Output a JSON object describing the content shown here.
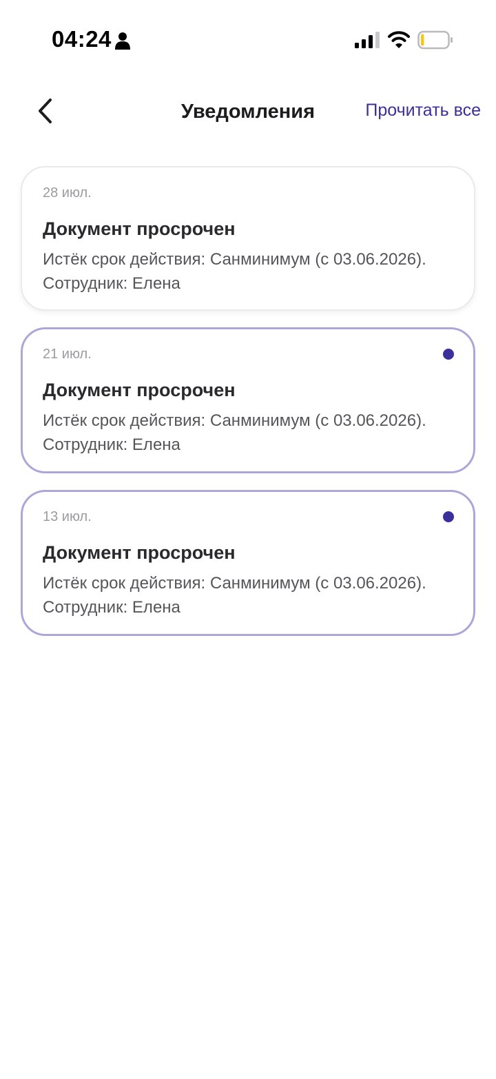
{
  "status_bar": {
    "time": "04:24",
    "icons": [
      "person-icon",
      "signal-icon",
      "wifi-icon",
      "battery-icon"
    ]
  },
  "header": {
    "title": "Уведомления",
    "read_all_label": "Прочитать все",
    "back_icon": "chevron-left-icon"
  },
  "colors": {
    "accent": "#3b2f9a",
    "unread_border": "#aea5d9",
    "unread_dot": "#3a2f9c",
    "battery_fill": "#f5c518"
  },
  "battery_level": 0.12,
  "notifications": [
    {
      "date": "28 июл.",
      "title": "Документ просрочен",
      "text": "Истёк срок действия: Санминимум (с 03.06.2026). Сотрудник: Елена",
      "unread": false
    },
    {
      "date": "21 июл.",
      "title": "Документ просрочен",
      "text": "Истёк срок действия: Санминимум (с 03.06.2026). Сотрудник: Елена",
      "unread": true
    },
    {
      "date": "13 июл.",
      "title": "Документ просрочен",
      "text": "Истёк срок действия: Санминимум (с 03.06.2026). Сотрудник: Елена",
      "unread": true
    }
  ]
}
